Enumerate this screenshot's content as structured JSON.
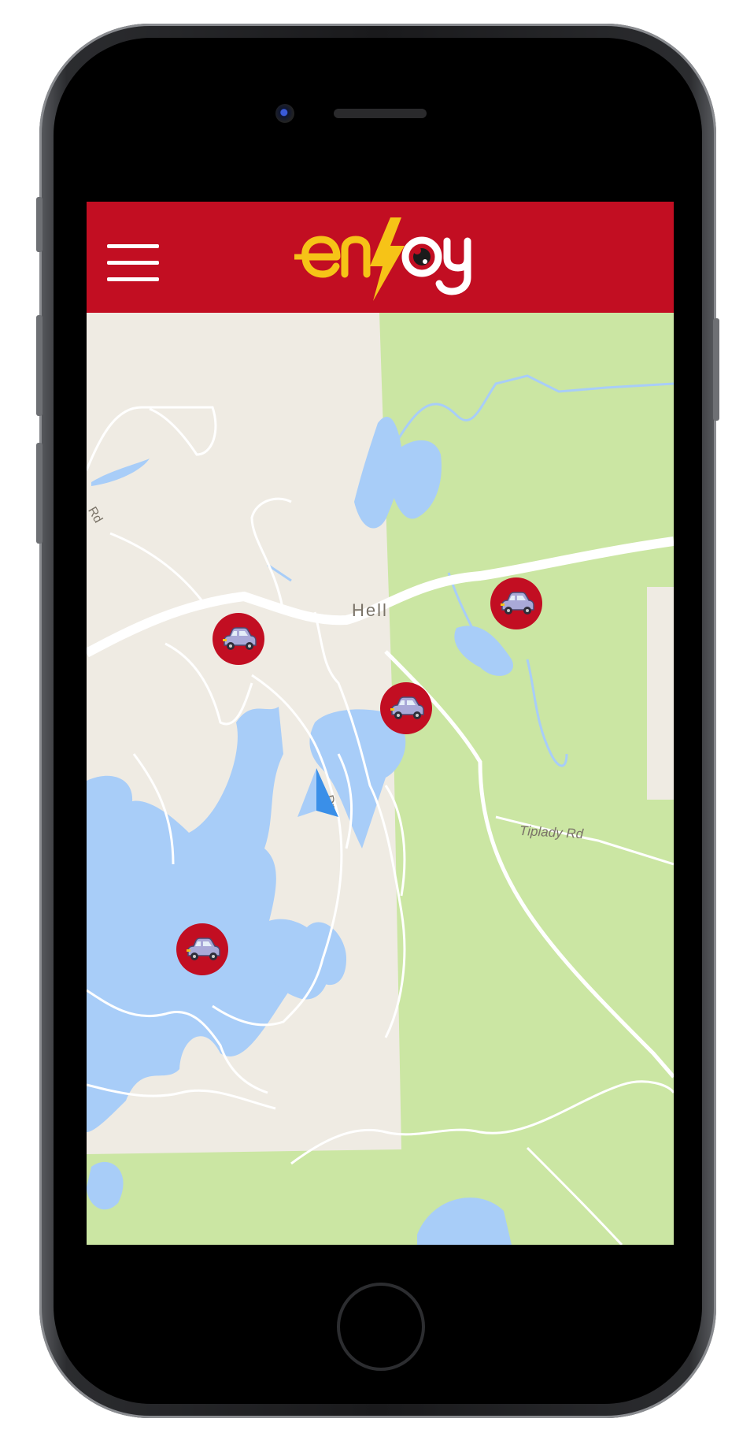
{
  "app": {
    "name": "enjoy",
    "brand_color": "#c20e22",
    "logo_yellow": "#f6c317"
  },
  "header": {
    "menu_icon": "hamburger-menu-icon",
    "logo_text": "enjoy"
  },
  "map": {
    "place_label": "Hell",
    "road_labels": {
      "tiplady": "Tiplady Rd",
      "west_road": "Rd",
      "drive": "Dr"
    },
    "colors": {
      "land": "#efebe3",
      "park": "#cbe6a3",
      "water": "#a8cdf8",
      "road": "#ffffff"
    },
    "markers": [
      {
        "type": "car",
        "icon": "car-icon"
      },
      {
        "type": "car",
        "icon": "car-icon"
      },
      {
        "type": "car",
        "icon": "car-icon"
      },
      {
        "type": "car",
        "icon": "car-icon"
      }
    ],
    "user_location_icon": "navigation-arrow-icon"
  }
}
